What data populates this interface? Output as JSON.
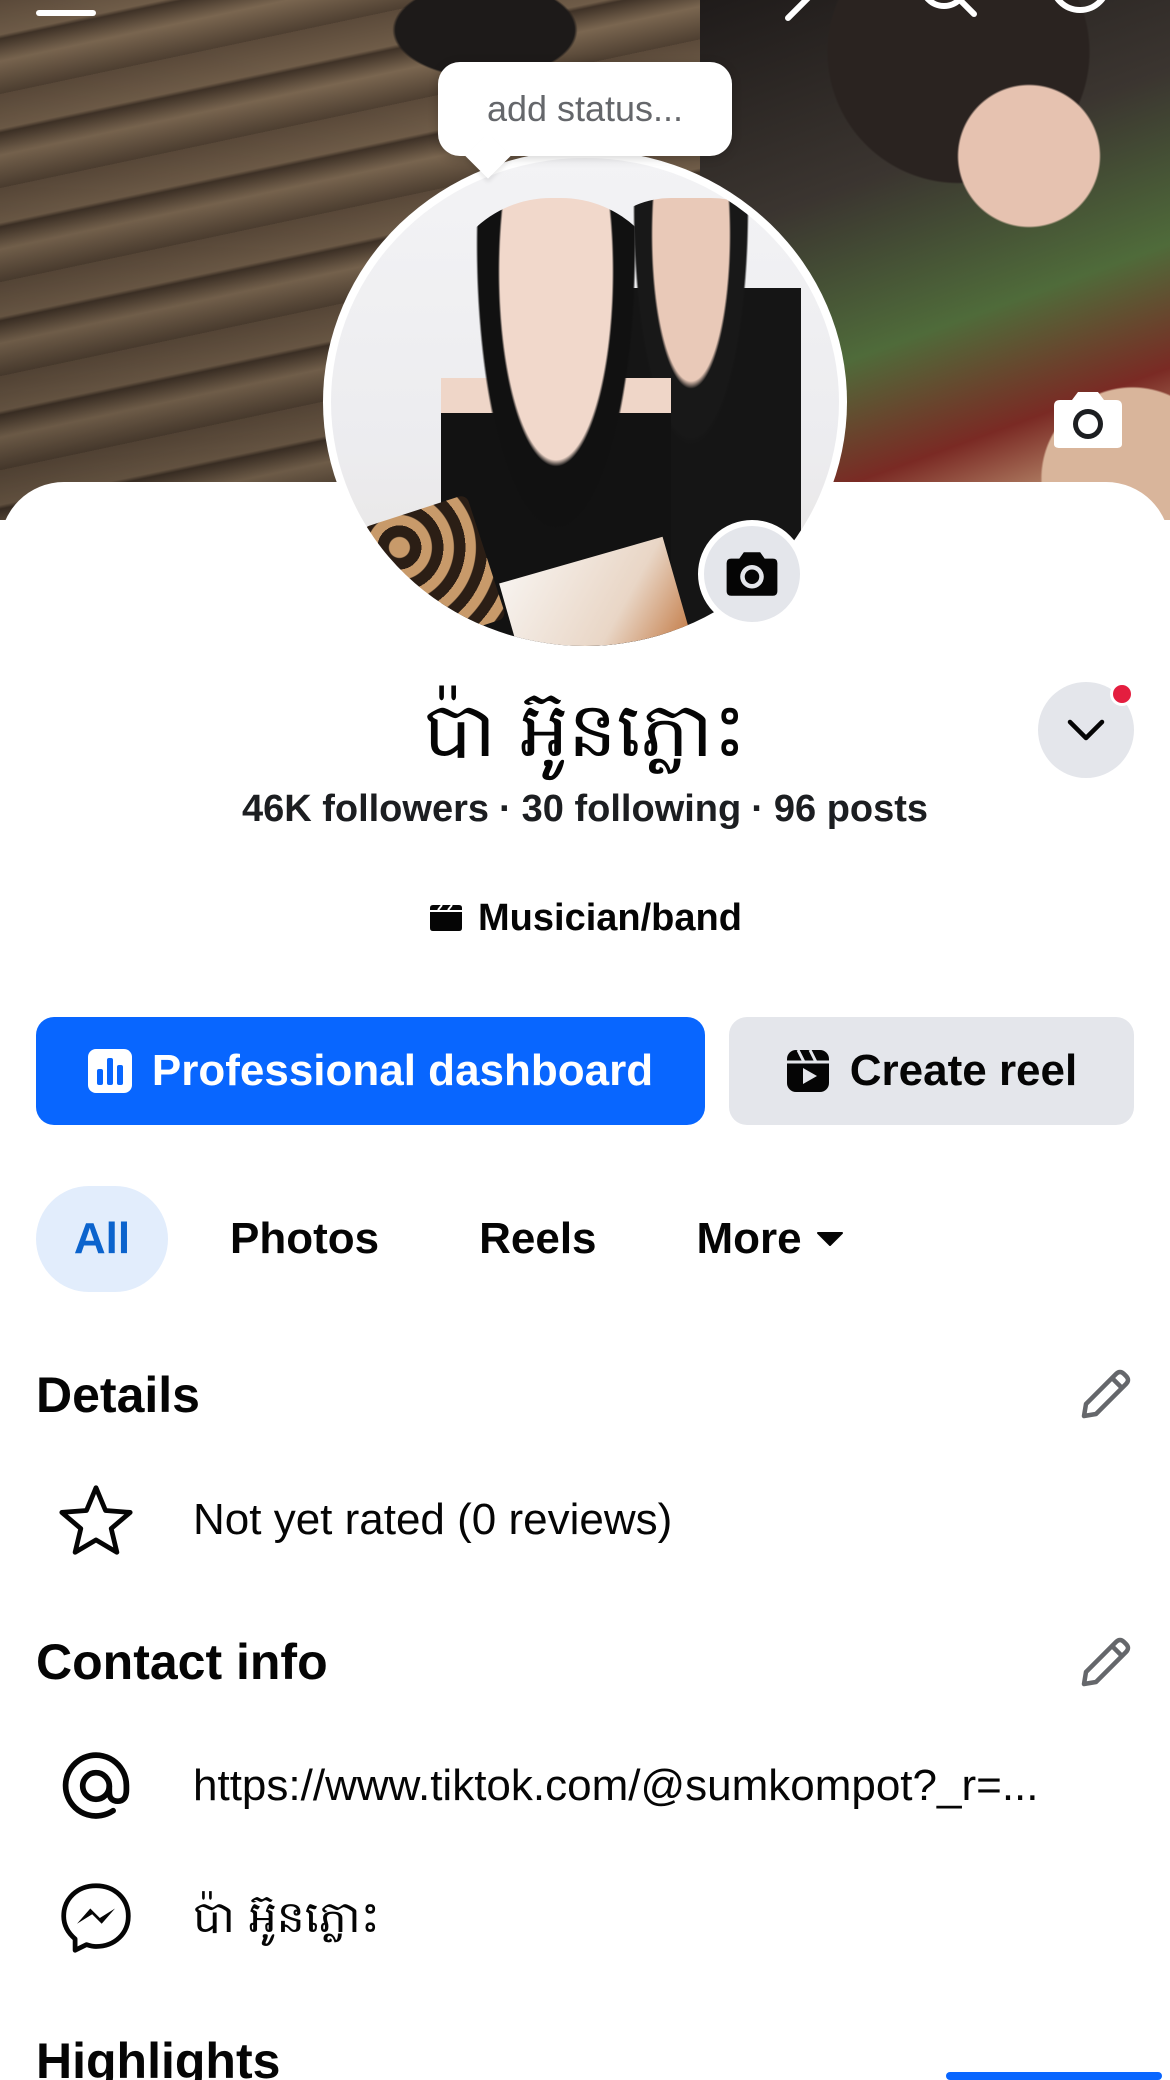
{
  "status": {
    "placeholder": "add status..."
  },
  "profile": {
    "name": "ប៉ា អ៊ូនភ្លោះ",
    "stats": {
      "followers": "46K followers",
      "following": "30 following",
      "posts": "96 posts",
      "separator": "·"
    },
    "category": "Musician/band"
  },
  "actions": {
    "dashboard_label": "Professional dashboard",
    "create_reel_label": "Create reel"
  },
  "tabs": [
    {
      "label": "All",
      "selected": true
    },
    {
      "label": "Photos",
      "selected": false
    },
    {
      "label": "Reels",
      "selected": false
    },
    {
      "label": "More",
      "selected": false
    }
  ],
  "details": {
    "title": "Details",
    "rating": "Not yet rated (0 reviews)"
  },
  "contact": {
    "title": "Contact info",
    "website": "https://www.tiktok.com/@sumkompot?_r=...",
    "messenger": "ប៉ា អ៊ូនភ្លោះ"
  },
  "highlights": {
    "title": "Highlights"
  },
  "colors": {
    "accent": "#0866ff",
    "tab_selected_bg": "#e2edfc",
    "tab_selected_text": "#0b63cd",
    "secondary_bg": "#e4e6eb",
    "notification": "#e41e3f"
  },
  "icons": {
    "menu": "menu-icon",
    "edit": "pencil-icon",
    "search": "search-icon",
    "cover_camera": "camera-icon",
    "avatar_camera": "camera-icon",
    "dropdown": "chevron-down-icon",
    "category": "clapperboard-icon",
    "dashboard": "bar-chart-icon",
    "reel": "reel-icon",
    "more": "caret-down-icon",
    "rating": "star-icon",
    "website": "at-sign-icon",
    "messenger": "messenger-icon"
  }
}
